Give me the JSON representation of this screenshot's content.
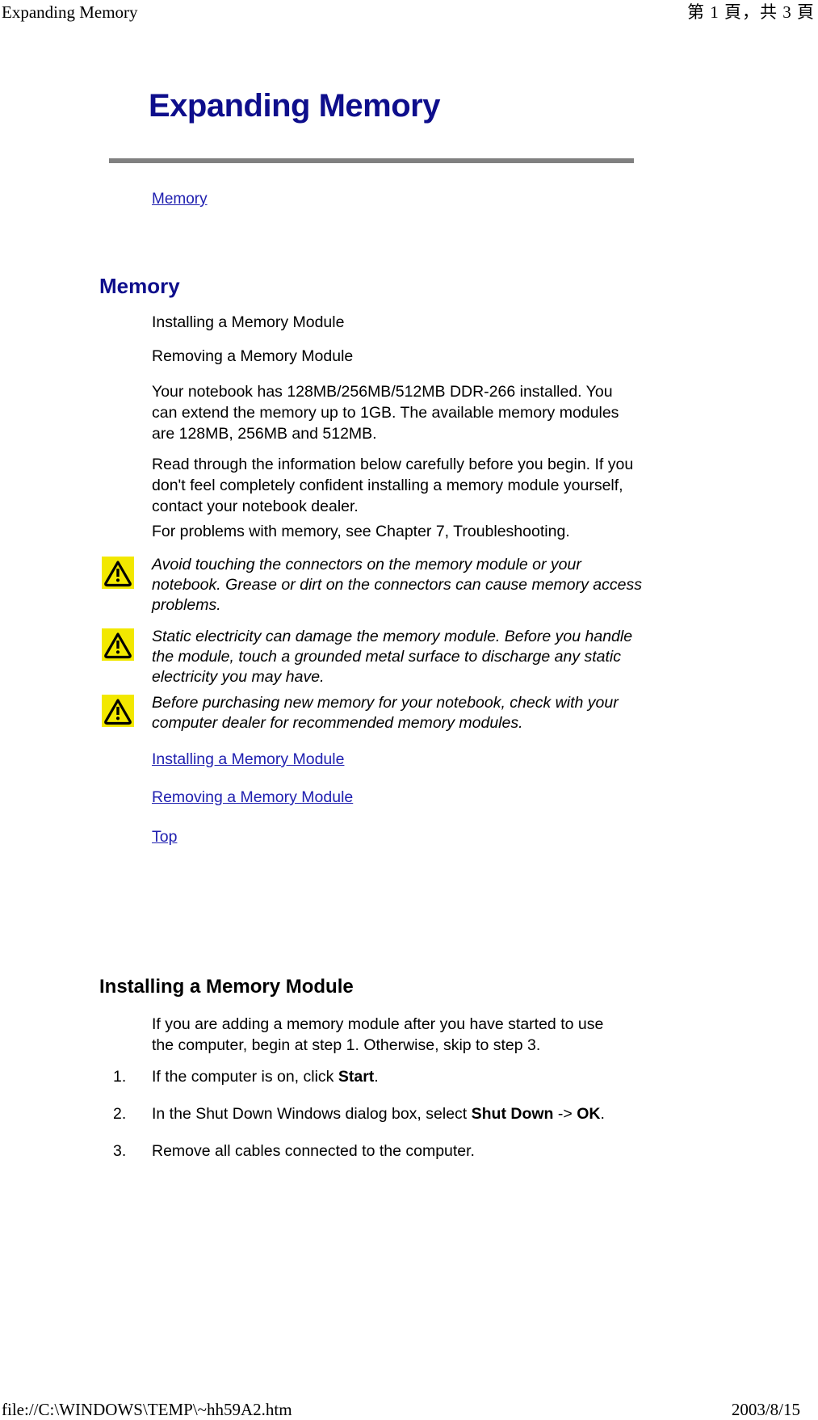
{
  "header": {
    "left": "Expanding Memory",
    "right": "第 1 頁，共 3 頁"
  },
  "footer": {
    "left": "file://C:\\WINDOWS\\TEMP\\~hh59A2.htm",
    "right": "2003/8/15"
  },
  "document": {
    "title": "Expanding Memory",
    "toc_link": "Memory",
    "section_heading": "Memory",
    "subitems": [
      "Installing a Memory Module",
      "Removing a Memory Module"
    ],
    "paragraphs": [
      "Your notebook has 128MB/256MB/512MB DDR-266 installed. You can extend the memory up to 1GB. The available memory modules are 128MB, 256MB and 512MB.",
      "Read through the information below carefully before you begin. If you don't feel completely confident installing a memory module yourself, contact your notebook dealer.",
      "For problems with memory, see Chapter 7, Troubleshooting."
    ],
    "notes": [
      "Avoid touching the connectors on the memory module or your notebook. Grease or dirt on the connectors can cause memory access problems.",
      "Static electricity can damage the memory module. Before you handle the module, touch a grounded metal surface to discharge any static electricity you may have.",
      "Before purchasing new memory for your notebook, check with your computer dealer for recommended memory modules."
    ],
    "links": [
      "Installing a Memory Module",
      "Removing a Memory Module",
      "Top"
    ],
    "install_heading": "Installing a Memory Module",
    "install_intro": "If you are adding a memory module after you have started to use the computer, begin at step 1. Otherwise, skip to step 3.",
    "steps": [
      {
        "num": "1.",
        "pre": "If the computer is on, click ",
        "bold": "Start",
        "post": "."
      },
      {
        "num": "2.",
        "pre": "In the Shut Down Windows dialog box, select ",
        "bold": "Shut Down",
        "mid": " -> ",
        "bold2": "OK",
        "post": "."
      },
      {
        "num": "3.",
        "pre": "Remove all cables connected to the computer.",
        "bold": "",
        "post": ""
      }
    ]
  },
  "colors": {
    "heading_navy": "#0e0e8c",
    "link_blue": "#2020b0",
    "rule_gray": "#808080",
    "warning_yellow": "#f2e800"
  }
}
